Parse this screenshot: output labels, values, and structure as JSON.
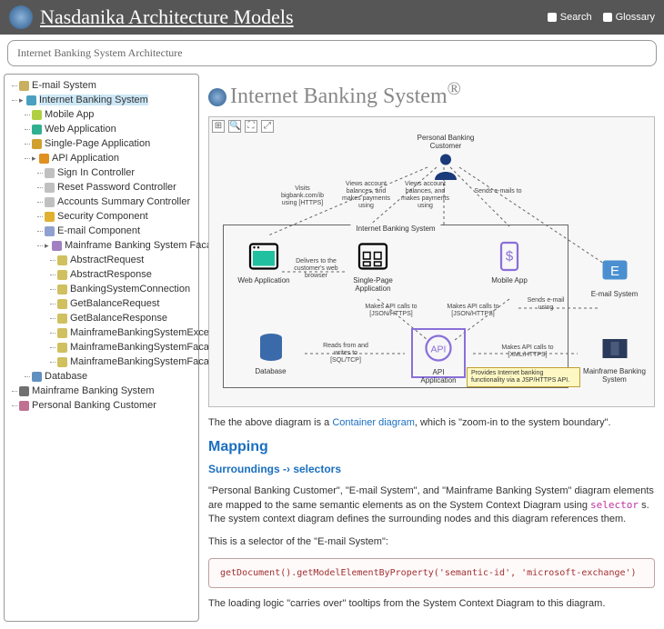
{
  "header": {
    "title": "Nasdanika Architecture Models",
    "search": "Search",
    "glossary": "Glossary"
  },
  "breadcrumb": "Internet Banking System Architecture",
  "tree": {
    "n0": "E-mail System",
    "n1": "Internet Banking System",
    "n1_0": "Mobile App",
    "n1_1": "Web Application",
    "n1_2": "Single-Page Application",
    "n1_3": "API Application",
    "n1_3_0": "Sign In Controller",
    "n1_3_1": "Reset Password Controller",
    "n1_3_2": "Accounts Summary Controller",
    "n1_3_3": "Security Component",
    "n1_3_4": "E-mail Component",
    "n1_3_5": "Mainframe Banking System Facade",
    "n1_3_5_0": "AbstractRequest",
    "n1_3_5_1": "AbstractResponse",
    "n1_3_5_2": "BankingSystemConnection",
    "n1_3_5_3": "GetBalanceRequest",
    "n1_3_5_4": "GetBalanceResponse",
    "n1_3_5_5": "MainframeBankingSystemException",
    "n1_3_5_6": "MainframeBankingSystemFacade",
    "n1_3_5_7": "MainframeBankingSystemFacadeImpl",
    "n1_4": "Database",
    "n2": "Mainframe Banking System",
    "n3": "Personal Banking Customer"
  },
  "page": {
    "title": "Internet Banking System",
    "sup": "®"
  },
  "diagram": {
    "customer": "Personal Banking Customer",
    "ibs": "Internet Banking System",
    "web": "Web Application",
    "spa": "Single-Page Application",
    "mob": "Mobile App",
    "api": "API Application",
    "db": "Database",
    "email": "E-mail System",
    "mf": "Mainframe Banking System",
    "e_visits": "Visits bigbank.com/ib using [HTTPS]",
    "e_views1": "Views account balances, and makes payments using",
    "e_views2": "Views account balances, and makes payments using",
    "e_sends": "Sends e-mails to",
    "e_delivers": "Delivers to the customer's web browser",
    "e_api1": "Makes API calls to [JSON/HTTPS]",
    "e_api2": "Makes API calls to [JSON/HTTPS]",
    "e_sends2": "Sends e-mail using",
    "e_reads": "Reads from and writes to [SQL/TCP]",
    "e_xml": "Makes API calls to [XML/HTTPS]",
    "tooltip": "Provides Internet banking functionality via a JSP/HTTPS API."
  },
  "body": {
    "p1a": "The the above diagram is a ",
    "p1link": "Container diagram",
    "p1b": ", which is \"zoom-in to the system boundary\".",
    "h2": "Mapping",
    "h3": "Surroundings -› selectors",
    "p2a": "\"Personal Banking Customer\", \"E-mail System\", and \"Mainframe Banking System\" diagram elements are mapped to the same semantic elements as on the System Context Diagram using ",
    "p2code": "selector",
    "p2b": " s. The system context diagram defines the surrounding nodes and this diagram references them.",
    "p3": "This is a selector of the \"E-mail System\":",
    "code": "getDocument().getModelElementByProperty('semantic-id', 'microsoft-exchange')",
    "p4": "The loading logic \"carries over\" tooltips from the System Context Diagram to this diagram."
  }
}
